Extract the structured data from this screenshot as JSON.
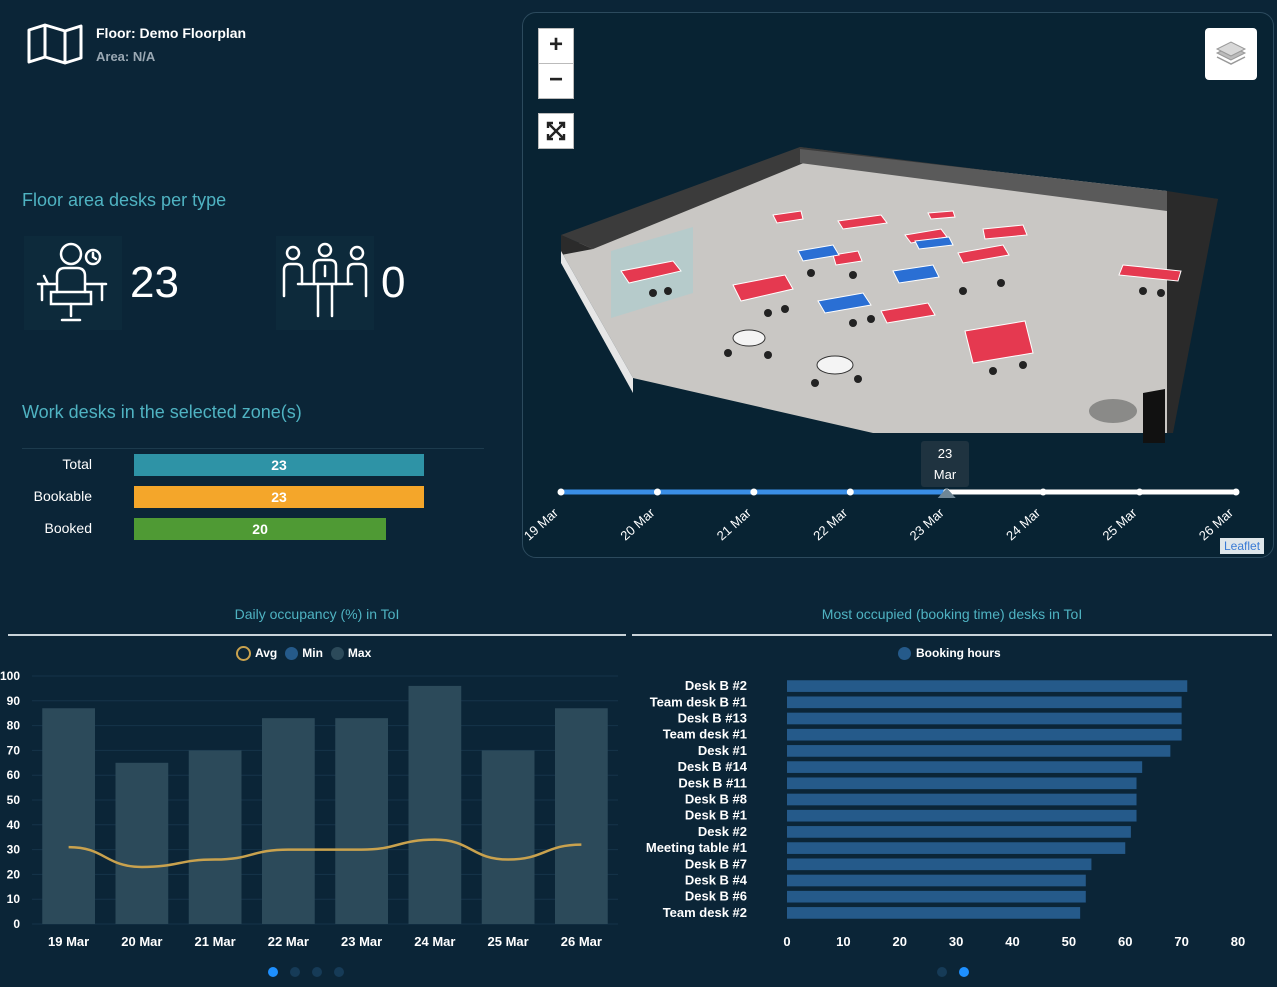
{
  "floor": {
    "title": "Floor: Demo Floorplan",
    "area": "Area: N/A"
  },
  "desk_types": {
    "title": "Floor area desks per type",
    "work_count": "23",
    "meeting_count": "0"
  },
  "work_desks": {
    "title": "Work desks in the selected zone(s)",
    "rows": [
      {
        "label": "Total",
        "value": 23,
        "color": "#2e93a6"
      },
      {
        "label": "Bookable",
        "value": 23,
        "color": "#f4a62a"
      },
      {
        "label": "Booked",
        "value": 20,
        "color": "#4f9a34"
      }
    ],
    "max": 23
  },
  "map": {
    "zoom_in": "+",
    "zoom_out": "−",
    "attribution": "Leaflet",
    "tooltip_line1": "23",
    "tooltip_line2": "Mar",
    "timeline": [
      "19 Mar",
      "20 Mar",
      "21 Mar",
      "22 Mar",
      "23 Mar",
      "24 Mar",
      "25 Mar",
      "26 Mar"
    ],
    "timeline_selected_index": 4,
    "colors": {
      "active": "#3a8ee6",
      "inactive": "#ffffff"
    }
  },
  "chart_data": [
    {
      "type": "bar",
      "title": "Daily occupancy (%) in ToI",
      "legend": [
        "Avg",
        "Min",
        "Max"
      ],
      "categories": [
        "19 Mar",
        "20 Mar",
        "21 Mar",
        "22 Mar",
        "23 Mar",
        "24 Mar",
        "25 Mar",
        "26 Mar"
      ],
      "series": [
        {
          "name": "Max",
          "type": "bar",
          "values": [
            87,
            65,
            70,
            83,
            83,
            96,
            70,
            87
          ]
        },
        {
          "name": "Avg",
          "type": "line",
          "values": [
            31,
            23,
            26,
            30,
            30,
            34,
            26,
            32
          ]
        }
      ],
      "ylim": [
        0,
        100
      ],
      "yticks": [
        "0",
        "10",
        "20",
        "30",
        "40",
        "50",
        "60",
        "70",
        "80",
        "90",
        "100"
      ],
      "colors": {
        "bar": "#2c4a5a",
        "line": "#c9a24e"
      }
    },
    {
      "type": "bar",
      "orientation": "horizontal",
      "title": "Most occupied (booking time) desks in ToI",
      "legend": [
        "Booking hours"
      ],
      "categories": [
        "Desk B #2",
        "Team desk B #1",
        "Desk B #13",
        "Team desk #1",
        "Desk #1",
        "Desk B #14",
        "Desk B #11",
        "Desk B #8",
        "Desk B #1",
        "Desk #2",
        "Meeting table #1",
        "Desk B #7",
        "Desk B #4",
        "Desk B #6",
        "Team desk #2"
      ],
      "series": [
        {
          "name": "Booking hours",
          "values": [
            71,
            70,
            70,
            70,
            68,
            63,
            62,
            62,
            62,
            61,
            60,
            54,
            53,
            53,
            52
          ]
        }
      ],
      "xlim": [
        0,
        80
      ],
      "xticks": [
        "0",
        "10",
        "20",
        "30",
        "40",
        "50",
        "60",
        "70",
        "80"
      ],
      "colors": {
        "bar": "#255a8a"
      }
    }
  ]
}
